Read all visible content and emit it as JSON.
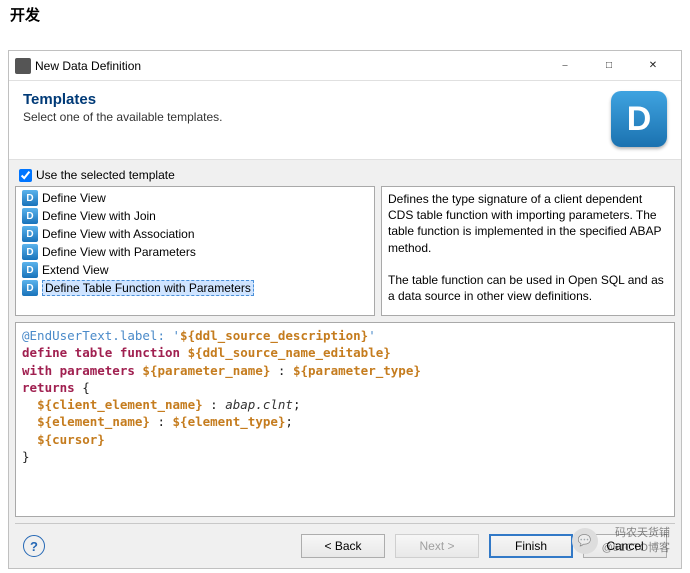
{
  "pageHeader": "开发",
  "dialog": {
    "title": "New Data Definition",
    "section": {
      "title": "Templates",
      "desc": "Select one of the available templates."
    },
    "badgeLetter": "D",
    "useTemplateLabel": "Use the selected template",
    "useTemplateChecked": true,
    "templates": {
      "items": [
        {
          "label": "Define View",
          "selected": false
        },
        {
          "label": "Define View with Join",
          "selected": false
        },
        {
          "label": "Define View with Association",
          "selected": false
        },
        {
          "label": "Define View with Parameters",
          "selected": false
        },
        {
          "label": "Extend View",
          "selected": false
        },
        {
          "label": "Define Table Function with Parameters",
          "selected": true
        }
      ]
    },
    "description": {
      "p1": "Defines the type signature of a client dependent CDS table function with importing parameters. The table function is implemented in the specified ABAP method.",
      "p2": "The table function can be used in Open SQL and as a data source in other view definitions."
    },
    "code": {
      "l1a": "@EndUserText.label: '",
      "l1b": "${ddl_source_description}",
      "l1c": "'",
      "l2a": "define table function ",
      "l2b": "${ddl_source_name_editable}",
      "l3a": "with parameters ",
      "l3b": "${parameter_name}",
      "l3c": " : ",
      "l3d": "${parameter_type}",
      "l4a": "returns",
      "l4b": " {",
      "l5a": "  ",
      "l5b": "${client_element_name}",
      "l5c": " : ",
      "l5d": "abap.clnt",
      "l5e": ";",
      "l6a": "  ",
      "l6b": "${element_name}",
      "l6c": " : ",
      "l6d": "${element_type}",
      "l6e": ";",
      "l7a": "  ",
      "l7b": "${cursor}",
      "l8": "}"
    },
    "buttons": {
      "back": "< Back",
      "next": "Next >",
      "finish": "Finish",
      "cancel": "Cancel"
    }
  },
  "watermark": {
    "line1": "码农天货铺",
    "line2": "@51CTO博客"
  }
}
